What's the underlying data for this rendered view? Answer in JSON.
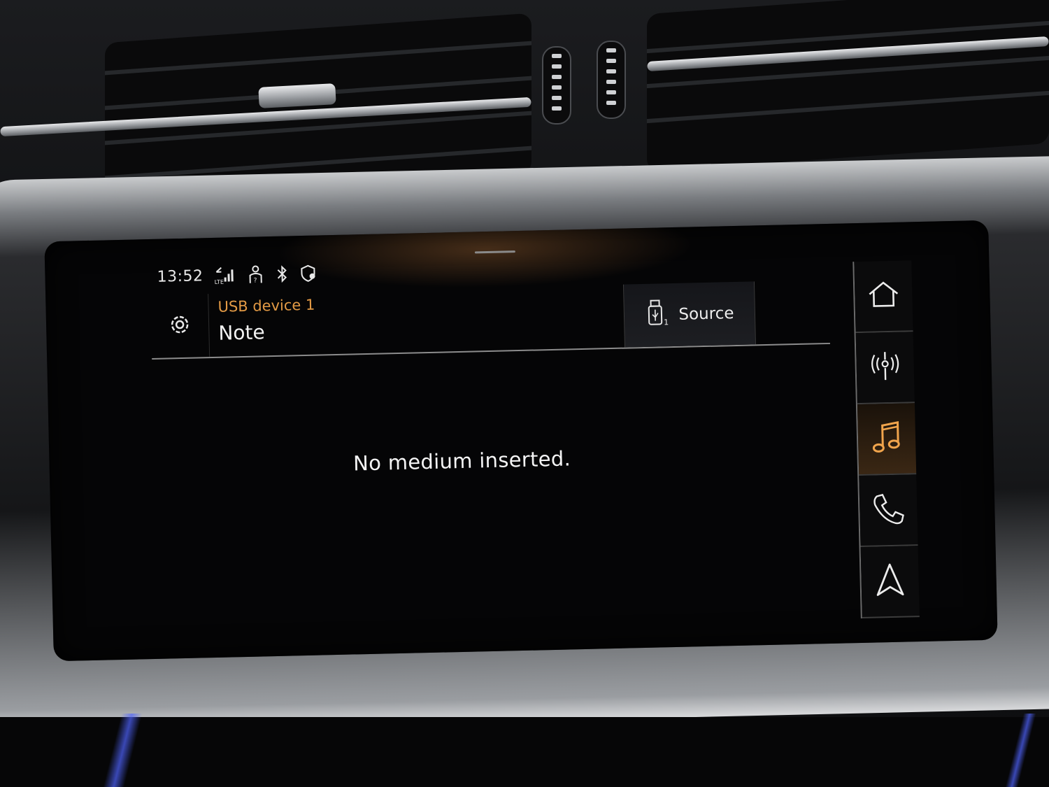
{
  "status_bar": {
    "time": "13:52",
    "icons": [
      "lte-signal-icon",
      "passenger-icon",
      "bluetooth-icon",
      "location-privacy-icon"
    ],
    "lte_label": "LTE"
  },
  "header": {
    "subtitle": "USB device 1",
    "title": "Note",
    "settings_icon": "gear-icon",
    "source_label": "Source",
    "source_icon": "usb-stick-icon",
    "source_index": "1"
  },
  "main": {
    "message": "No medium inserted."
  },
  "side_nav": {
    "items": [
      {
        "icon": "home-icon",
        "active": false
      },
      {
        "icon": "radio-antenna-icon",
        "active": false
      },
      {
        "icon": "music-note-icon",
        "active": true
      },
      {
        "icon": "phone-icon",
        "active": false
      },
      {
        "icon": "navigation-arrow-icon",
        "active": false
      }
    ]
  },
  "colors": {
    "accent": "#e39a45",
    "text": "#f2f2f2",
    "screen_bg": "#050506"
  }
}
